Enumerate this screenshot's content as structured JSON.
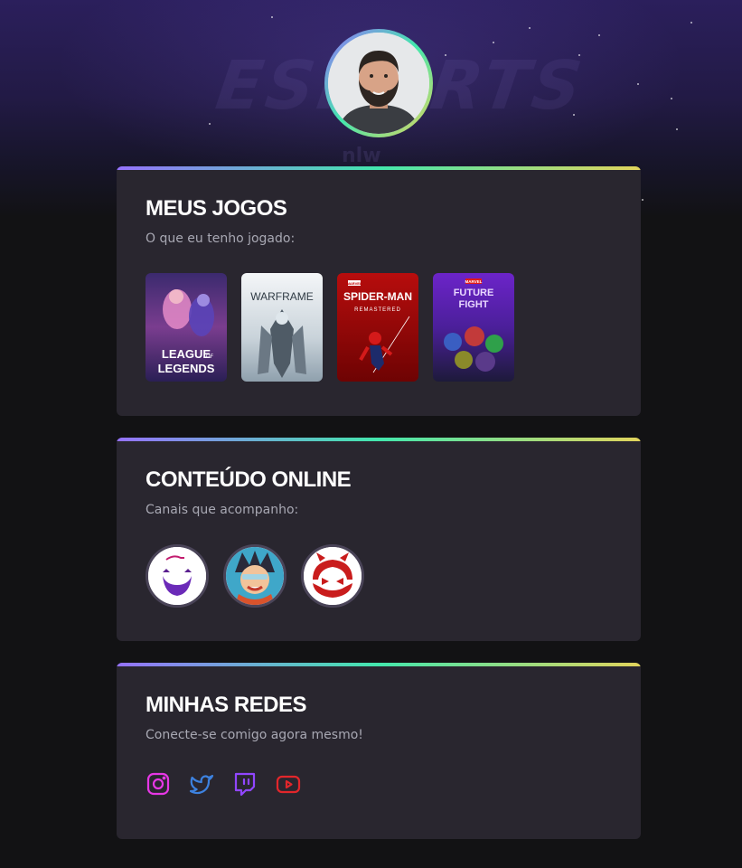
{
  "profile": {
    "avatar_icon": "profile-photo"
  },
  "games_card": {
    "title": "MEUS JOGOS",
    "subtitle": "O que eu tenho jogado:",
    "games": [
      {
        "id": "lol",
        "line1": "LEAGUE",
        "line_of": "OF",
        "line2": "LEGENDS"
      },
      {
        "id": "warframe",
        "name": "WARFRAME"
      },
      {
        "id": "spiderman",
        "brand": "MARVEL",
        "name": "SPIDER-MAN",
        "sub": "REMASTERED"
      },
      {
        "id": "futurefight",
        "brand": "MARVEL",
        "line1": "FUTURE",
        "line2": "FIGHT"
      }
    ]
  },
  "channels_card": {
    "title": "CONTEÚDO ONLINE",
    "subtitle": "Canais que acompanho:",
    "channels": [
      {
        "icon": "purple-beard-channel-icon"
      },
      {
        "icon": "anime-character-channel-icon"
      },
      {
        "icon": "red-devil-channel-icon"
      }
    ]
  },
  "social_card": {
    "title": "MINHAS REDES",
    "subtitle": "Conecte-se comigo agora mesmo!",
    "networks": [
      {
        "icon": "instagram-icon",
        "color": "#e637e5"
      },
      {
        "icon": "twitter-icon",
        "color": "#3d82e0"
      },
      {
        "icon": "twitch-icon",
        "color": "#9146ff"
      },
      {
        "icon": "youtube-icon",
        "color": "#e2262b"
      }
    ]
  },
  "colors": {
    "page_bg": "#121214",
    "card_bg": "#29262f",
    "gradient": [
      "#9572fc",
      "#43e7ad",
      "#e2d45c"
    ],
    "subtitle": "#a8a8b3"
  }
}
